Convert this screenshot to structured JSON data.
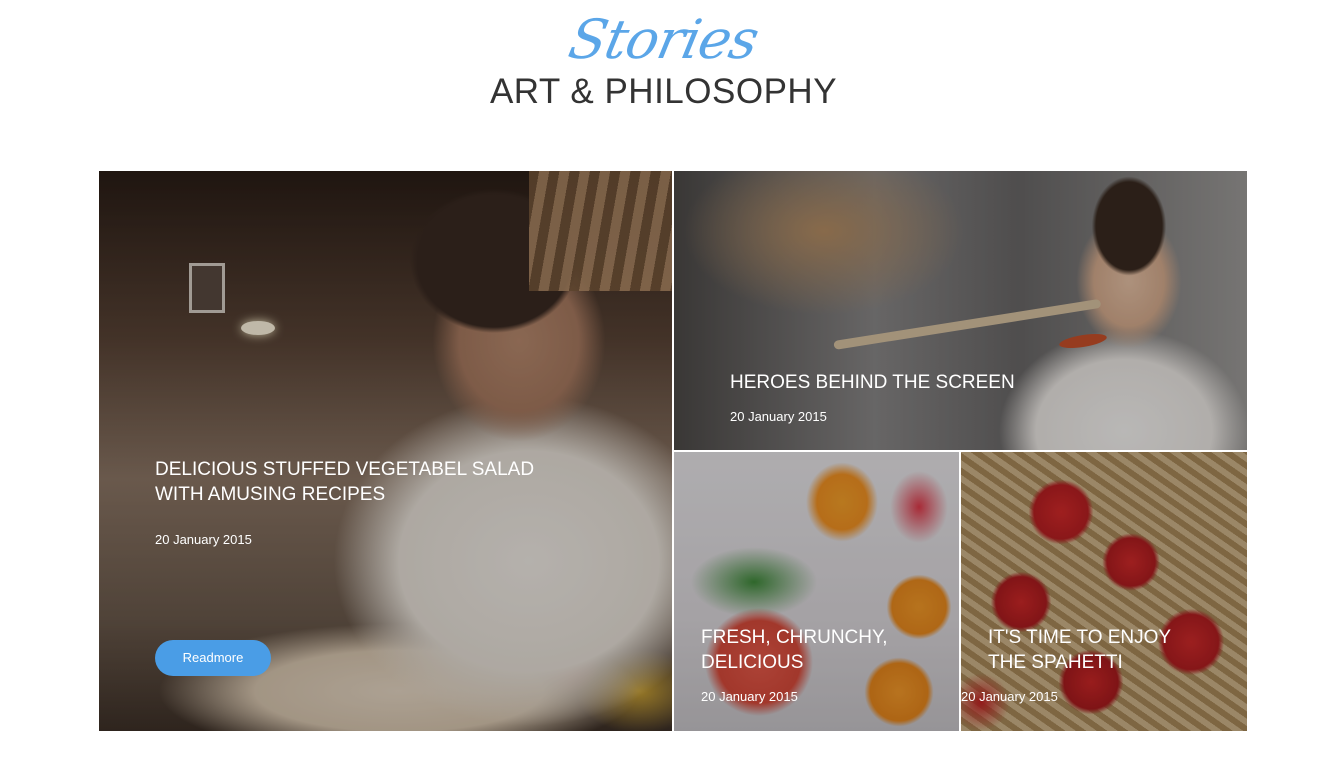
{
  "header": {
    "script_title": "Stories",
    "main_title": "ART & PHILOSOPHY"
  },
  "cards": [
    {
      "title_line1": "DELICIOUS STUFFED VEGETABEL SALAD",
      "title_line2": "WITH AMUSING RECIPES",
      "date": "20 January 2015",
      "button_label": "Readmore"
    },
    {
      "title_line1": "HEROES BEHIND THE SCREEN",
      "date": "20 January 2015"
    },
    {
      "title_line1": "FRESH, CHRUNCHY,",
      "title_line2": "DELICIOUS",
      "date": "20 January 2015"
    },
    {
      "title_line1": "IT'S TIME TO ENJOY",
      "title_line2": "THE SPAHETTI",
      "date": "20 January 2015"
    }
  ],
  "colors": {
    "accent": "#4a9de6",
    "heading": "#333333"
  }
}
